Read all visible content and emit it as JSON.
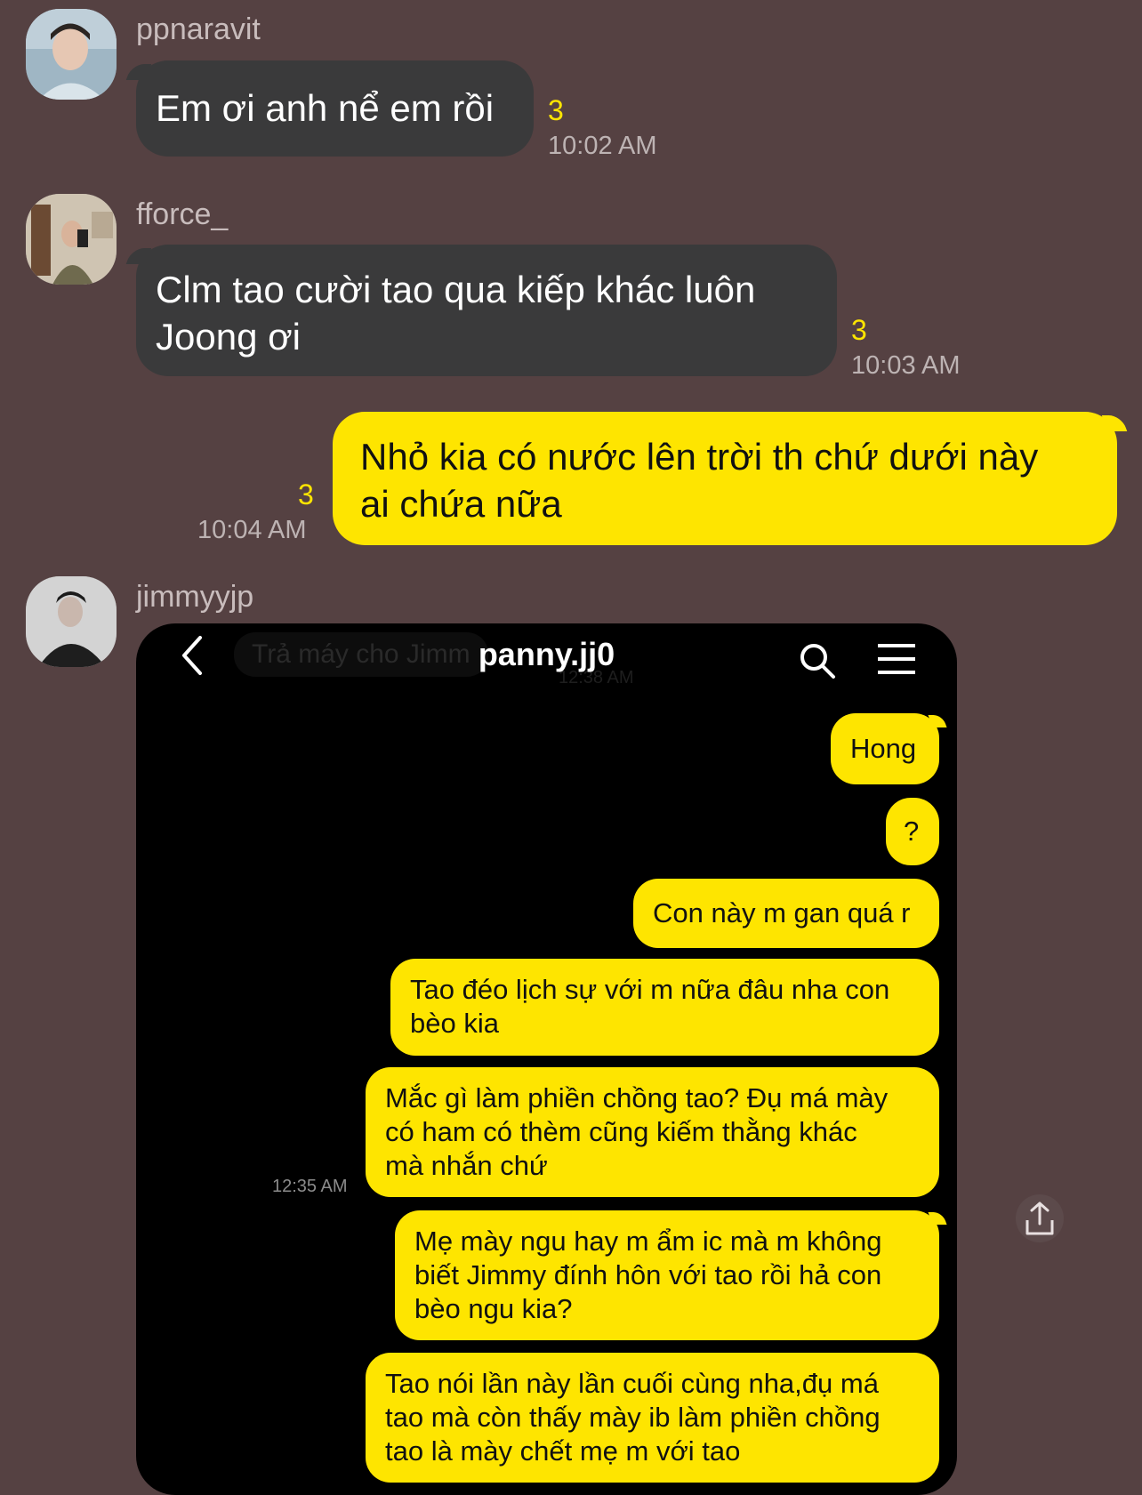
{
  "messages": [
    {
      "sender": "ppnaravit",
      "text": "Em ơi anh nể em rồi",
      "unread": "3",
      "time": "10:02 AM"
    },
    {
      "sender": "fforce_",
      "text_lines": [
        "Clm tao cười tao qua kiếp khác luôn",
        "Joong ơi"
      ],
      "unread": "3",
      "time": "10:03 AM"
    },
    {
      "sender": "",
      "text_lines": [
        "Nhỏ kia có nước lên trời th chứ dưới này",
        "ai chứa nữa"
      ],
      "unread": "3",
      "time": "10:04 AM"
    },
    {
      "sender": "jimmyyjp"
    }
  ],
  "screenshot": {
    "title": "panny.jj0",
    "ghost_text": "Trả máy cho Jimm",
    "ghost_time": "12:38 AM",
    "time": "12:35 AM",
    "bubbles": [
      {
        "lines": [
          "Hong"
        ]
      },
      {
        "lines": [
          "?"
        ]
      },
      {
        "lines": [
          "Con này m gan quá r"
        ]
      },
      {
        "lines": [
          "Tao đéo lịch sự với m nữa đâu nha con",
          "bèo kia"
        ]
      },
      {
        "lines": [
          "Mắc gì làm phiền chồng tao? Đụ má mày",
          "có ham có thèm cũng kiếm thằng khác",
          "mà nhắn chứ"
        ]
      },
      {
        "lines": [
          "Mẹ mày ngu hay m ẩm ic mà m không",
          "biết Jimmy đính hôn với tao rồi hả con",
          "bèo ngu kia?"
        ]
      },
      {
        "lines": [
          "Tao nói lần này lần cuối cùng nha,đụ má",
          "tao mà còn thấy mày ib làm phiền chồng",
          "tao là mày chết mẹ m với tao"
        ]
      }
    ],
    "icons": [
      "chevron-left-icon",
      "search-icon",
      "menu-icon"
    ]
  },
  "share_icon": "share-icon",
  "colors": {
    "background": "#554142",
    "incoming_bubble": "#3a3a3b",
    "outgoing_bubble": "#fee500",
    "unread": "#fee500"
  }
}
